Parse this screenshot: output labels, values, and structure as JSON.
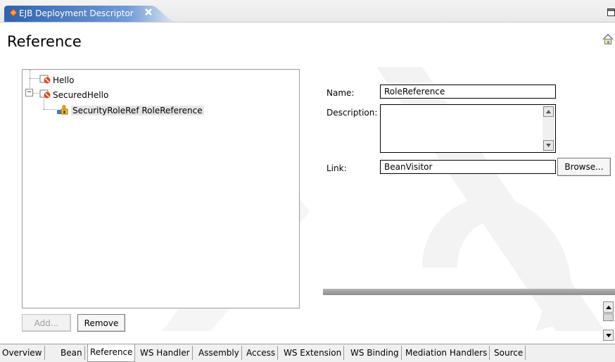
{
  "editor_tab": {
    "title": "EJB Deployment Descriptor"
  },
  "header": {
    "title": "Reference"
  },
  "tree": {
    "items": [
      {
        "label": "Hello"
      },
      {
        "label": "SecuredHello",
        "expander": "−"
      },
      {
        "label": "SecurityRoleRef RoleReference"
      }
    ]
  },
  "buttons": {
    "add": "Add...",
    "remove": "Remove",
    "browse": "Browse..."
  },
  "form": {
    "name_label": "Name:",
    "name_value": "RoleReference",
    "description_label": "Description:",
    "description_value": "",
    "link_label": "Link:",
    "link_value": "BeanVisitor"
  },
  "page_tabs": [
    "Overview",
    "Bean",
    "Reference",
    "WS Handler",
    "Assembly",
    "Access",
    "WS Extension",
    "WS Binding",
    "Mediation Handlers",
    "Source"
  ],
  "active_page_tab": "Reference",
  "colors": {
    "tab_active": "#3b6fb6",
    "watermark": "#f4f4f4",
    "splitter": "#9a9a9a"
  }
}
